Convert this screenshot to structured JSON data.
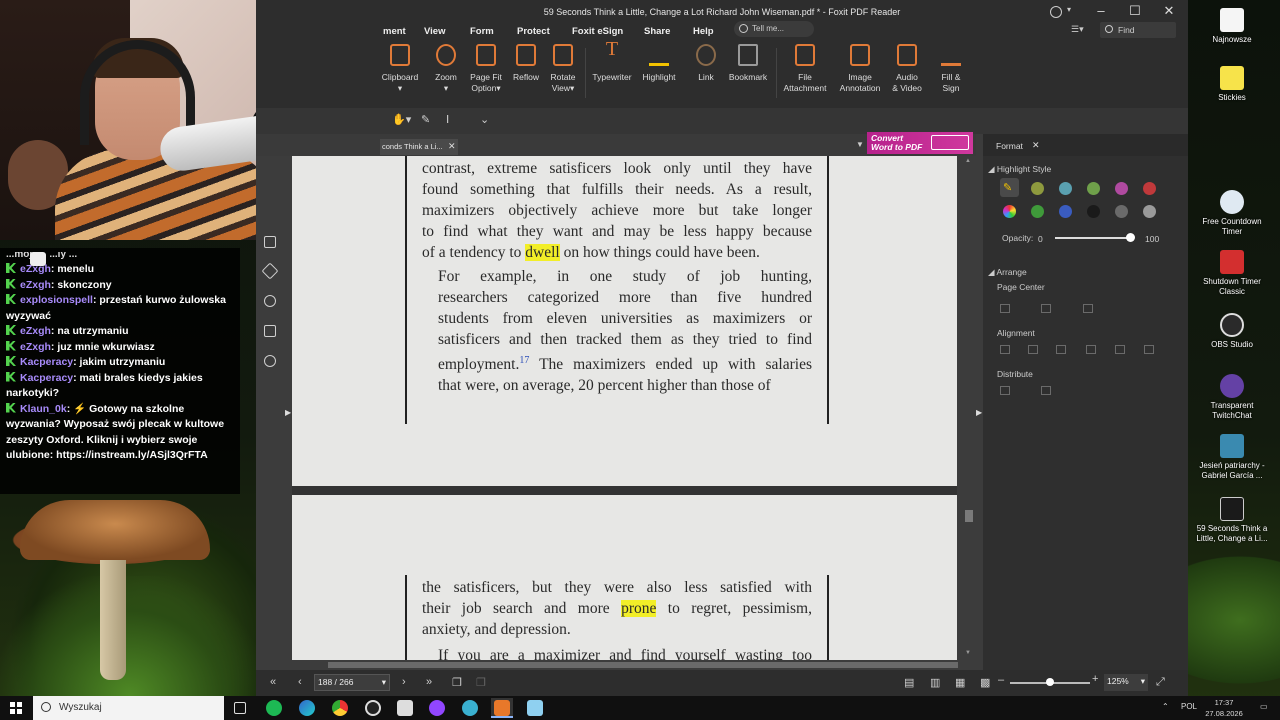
{
  "foxit": {
    "title": "59 Seconds Think a Little, Change a Lot Richard John Wiseman.pdf * - Foxit PDF Reader",
    "menu": [
      "ment",
      "View",
      "Form",
      "Protect",
      "Foxit eSign",
      "Share",
      "Help"
    ],
    "tell_me": "Tell me...",
    "find": "Find",
    "ribbon": {
      "clipboard": "Clipboard",
      "zoom": "Zoom",
      "page_fit_1": "Page Fit",
      "page_fit_2": "Option",
      "reflow": "Reflow",
      "rotate_1": "Rotate",
      "rotate_2": "View",
      "typewriter": "Typewriter",
      "highlight": "Highlight",
      "link": "Link",
      "bookmark": "Bookmark",
      "file_att_1": "File",
      "file_att_2": "Attachment",
      "image_ann_1": "Image",
      "image_ann_2": "Annotation",
      "audio_1": "Audio",
      "audio_2": "& Video",
      "fill_1": "Fill &",
      "fill_2": "Sign"
    },
    "doc_tab": "conds Think a Li...",
    "convert_banner": {
      "line1": "Convert",
      "line2": "Word to PDF"
    },
    "page1": {
      "para1": [
        "contrast, extreme satisficers look only until they have",
        "found something that fulfills their needs. As a result,",
        "maximizers objectively achieve more but take longer",
        "to find what they want and may be less happy because",
        {
          "pre": "of a tendency to ",
          "hl": "dwell",
          "post": " on how things could have been."
        }
      ],
      "para2": [
        "For example, in one study of job hunting,",
        "researchers categorized more than five hundred",
        "students from eleven universities as maximizers or",
        "satisficers and then tracked them as they tried to find",
        {
          "pre": "employment.",
          "fn": "17",
          "post": " The maximizers ended up with salaries"
        },
        "that were, on average, 20 percent higher than those of"
      ]
    },
    "page2": {
      "para1": [
        "the satisficers, but they were also less satisfied with",
        {
          "pre": "their job search and more ",
          "hl": "prone",
          "post": " to regret, pessimism,"
        },
        "anxiety, and depression."
      ],
      "para2_first": "If you are a maximizer and find yourself wasting too"
    },
    "format_panel": {
      "tab": "Format",
      "highlight_style": "Highlight Style",
      "opacity_label": "Opacity:",
      "opacity_min": "0",
      "opacity_max": "100",
      "opacity_value": 100,
      "arrange": "Arrange",
      "page_center": "Page Center",
      "alignment": "Alignment",
      "distribute": "Distribute",
      "swatches_row1": [
        "#8e9a3e",
        "#5aa0b0",
        "#6fa04a",
        "#b04aa0",
        "#c0393b"
      ],
      "swatches_row2": [
        "#3f9a3a",
        "#3a5cc0",
        "#1a1a1a",
        "#6a6a6a",
        "#9a9a9a"
      ]
    },
    "status": {
      "page": "188 / 266",
      "zoom": "125%"
    }
  },
  "chat": {
    "partial_top": "...mojo... ...ly ...",
    "messages": [
      {
        "user": "eZxgh",
        "text": "menelu"
      },
      {
        "user": "eZxgh",
        "text": "skonczony"
      },
      {
        "user": "explosionspell",
        "text": "przestań kurwo żulowska wyzywać"
      },
      {
        "user": "eZxgh",
        "text": "na utrzymaniu"
      },
      {
        "user": "eZxgh",
        "text": "juz mnie wkurwiasz"
      },
      {
        "user": "Kacperacy",
        "text": "jakim utrzymaniu"
      },
      {
        "user": "Kacperacy",
        "text": "mati brales kiedys jakies narkotyki?"
      },
      {
        "user": "Klaun_0k",
        "text": "⚡ Gotowy na szkolne wyzwania? Wyposaż swój plecak w kultowe zeszyty Oxford. Kliknij i wybierz swoje ulubione: https://instream.ly/ASjl3QrFTA"
      }
    ]
  },
  "desktop_icons": [
    {
      "label": "Najnowsze"
    },
    {
      "label": "Stickies"
    },
    {
      "label": "Free Countdown Timer"
    },
    {
      "label": "Shutdown Timer Classic"
    },
    {
      "label": "OBS Studio"
    },
    {
      "label": "Transparent TwitchChat"
    },
    {
      "label": "Jesień patriarchy - Gabriel García ..."
    },
    {
      "label": "59 Seconds Think a Little, Change a Li..."
    }
  ],
  "taskbar": {
    "search_placeholder": "Wyszukaj",
    "lang": "POL",
    "time": "17:37",
    "date": "27.08.2026"
  }
}
